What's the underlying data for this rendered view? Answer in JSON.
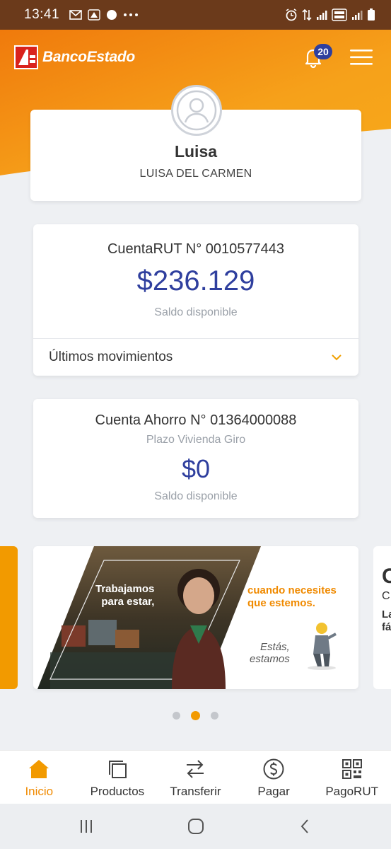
{
  "status_bar": {
    "time": "13:41",
    "left_icons": [
      "gmail-icon",
      "signal-app-icon",
      "dot-icon",
      "more-icon"
    ],
    "right_icons": [
      "alarm-icon",
      "data-icon",
      "signal-icon",
      "volte-icon",
      "signal2-icon",
      "battery-icon"
    ]
  },
  "header": {
    "brand": "BancoEstado",
    "notification_count": "20"
  },
  "profile": {
    "name": "Luisa",
    "full_name": "LUISA DEL CARMEN"
  },
  "accounts": [
    {
      "title": "CuentaRUT N° 0010577443",
      "amount": "$236.129",
      "label": "Saldo disponible",
      "movements_label": "Últimos movimientos"
    },
    {
      "title": "Cuenta Ahorro N° 01364000088",
      "subtitle": "Plazo Vivienda Giro",
      "amount": "$0",
      "label": "Saldo disponible"
    }
  ],
  "banner": {
    "left_text_line1": "Trabajamos",
    "left_text_line2": "para estar,",
    "right_text_line1": "cuando necesites",
    "right_text_line2": "que estemos.",
    "slogan_line1": "Estás,",
    "slogan_line2": "estamos"
  },
  "next_banner_peek": {
    "big": "C",
    "mid": "C",
    "line1": "La",
    "line2": "fá"
  },
  "carousel": {
    "active_index": 1,
    "count": 3
  },
  "bottom_nav": [
    {
      "label": "Inicio",
      "icon": "home-icon",
      "active": true
    },
    {
      "label": "Productos",
      "icon": "products-icon",
      "active": false
    },
    {
      "label": "Transferir",
      "icon": "transfer-icon",
      "active": false
    },
    {
      "label": "Pagar",
      "icon": "pay-icon",
      "active": false
    },
    {
      "label": "PagoRUT",
      "icon": "qr-icon",
      "active": false
    }
  ],
  "colors": {
    "brand_orange": "#f29a00",
    "amount_blue": "#2f3f9e",
    "badge_blue": "#2e3f9e"
  }
}
